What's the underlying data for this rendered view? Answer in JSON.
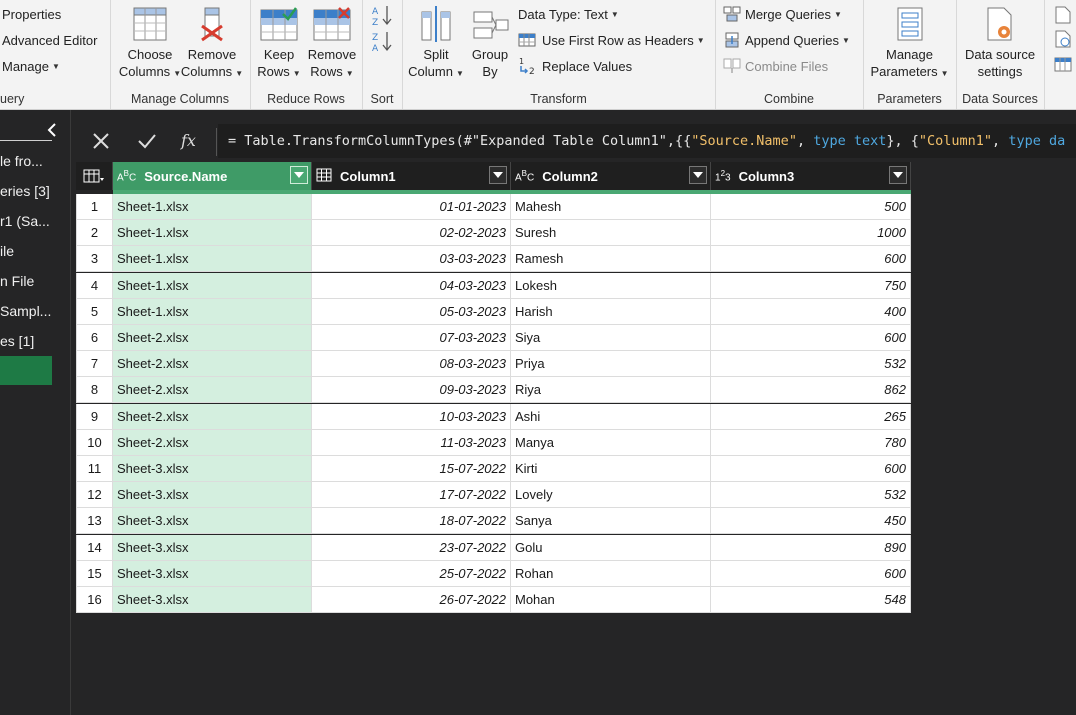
{
  "ribbon": {
    "query_group": {
      "label": "uery",
      "items": [
        "Properties",
        "Advanced Editor",
        "Manage"
      ]
    },
    "manage_columns": {
      "label": "Manage Columns",
      "choose": [
        "Choose",
        "Columns"
      ],
      "remove": [
        "Remove",
        "Columns"
      ]
    },
    "reduce_rows": {
      "label": "Reduce Rows",
      "keep": [
        "Keep",
        "Rows"
      ],
      "remove": [
        "Remove",
        "Rows"
      ]
    },
    "sort": {
      "label": "Sort"
    },
    "transform": {
      "label": "Transform",
      "split": [
        "Split",
        "Column"
      ],
      "group": [
        "Group",
        "By"
      ],
      "data_type": "Data Type: Text",
      "first_row": "Use First Row as Headers",
      "replace": "Replace Values"
    },
    "combine": {
      "label": "Combine",
      "merge": "Merge Queries",
      "append": "Append Queries",
      "combine_files": "Combine Files"
    },
    "parameters": {
      "label": "Parameters",
      "manage": [
        "Manage",
        "Parameters"
      ]
    },
    "data_sources": {
      "label": "Data Sources",
      "settings": [
        "Data source",
        "settings"
      ]
    }
  },
  "left_pane": {
    "items": [
      "le fro...",
      "eries [3]",
      "r1 (Sa...",
      "ile",
      "n File",
      "Sampl...",
      "es [1]"
    ]
  },
  "formula": {
    "prefix": "= Table.TransformColumnTypes(#\"Expanded Table Column1\",{{",
    "s1": "\"Source.Name\"",
    "t1": "type text",
    "mid": "}, {",
    "s2": "\"Column1\"",
    "t2": "type da"
  },
  "table": {
    "columns": [
      {
        "type_icon": "ABC",
        "name": "Source.Name"
      },
      {
        "type_icon": "table-icon",
        "name": "Column1"
      },
      {
        "type_icon": "ABC",
        "name": "Column2"
      },
      {
        "type_icon": "123",
        "name": "Column3"
      }
    ],
    "rows": [
      [
        "1",
        "Sheet-1.xlsx",
        "01-01-2023",
        "Mahesh",
        "500"
      ],
      [
        "2",
        "Sheet-1.xlsx",
        "02-02-2023",
        "Suresh",
        "1000"
      ],
      [
        "3",
        "Sheet-1.xlsx",
        "03-03-2023",
        "Ramesh",
        "600"
      ],
      [
        "4",
        "Sheet-1.xlsx",
        "04-03-2023",
        "Lokesh",
        "750"
      ],
      [
        "5",
        "Sheet-1.xlsx",
        "05-03-2023",
        "Harish",
        "400"
      ],
      [
        "6",
        "Sheet-2.xlsx",
        "07-03-2023",
        "Siya",
        "600"
      ],
      [
        "7",
        "Sheet-2.xlsx",
        "08-03-2023",
        "Priya",
        "532"
      ],
      [
        "8",
        "Sheet-2.xlsx",
        "09-03-2023",
        "Riya",
        "862"
      ],
      [
        "9",
        "Sheet-2.xlsx",
        "10-03-2023",
        "Ashi",
        "265"
      ],
      [
        "10",
        "Sheet-2.xlsx",
        "11-03-2023",
        "Manya",
        "780"
      ],
      [
        "11",
        "Sheet-3.xlsx",
        "15-07-2022",
        "Kirti",
        "600"
      ],
      [
        "12",
        "Sheet-3.xlsx",
        "17-07-2022",
        "Lovely",
        "532"
      ],
      [
        "13",
        "Sheet-3.xlsx",
        "18-07-2022",
        "Sanya",
        "450"
      ],
      [
        "14",
        "Sheet-3.xlsx",
        "23-07-2022",
        "Golu",
        "890"
      ],
      [
        "15",
        "Sheet-3.xlsx",
        "25-07-2022",
        "Rohan",
        "600"
      ],
      [
        "16",
        "Sheet-3.xlsx",
        "26-07-2022",
        "Mohan",
        "548"
      ]
    ]
  },
  "colors": {
    "accent": "#3f9b67",
    "selected_column": "#d4efdf",
    "background": "#252526"
  }
}
